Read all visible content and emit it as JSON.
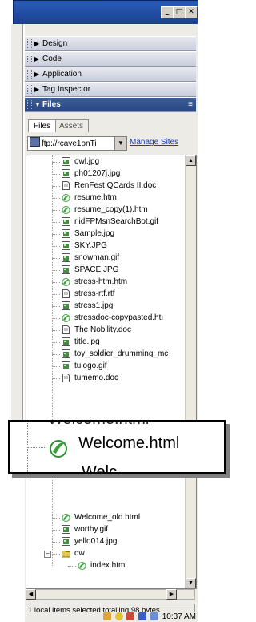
{
  "window": {
    "buttons": {
      "minimize": "_",
      "restore": "□",
      "close": "✕"
    }
  },
  "panels": [
    {
      "label": "Design",
      "expanded": false
    },
    {
      "label": "Code",
      "expanded": false
    },
    {
      "label": "Application",
      "expanded": false
    },
    {
      "label": "Tag Inspector",
      "expanded": false
    }
  ],
  "files_panel": {
    "label": "Files",
    "tabs": [
      "Files",
      "Assets"
    ],
    "active_tab": "Files",
    "site_select": "ftp://rcave1onTi",
    "manage_sites": "Manage Sites",
    "items": [
      {
        "name": "owl.jpg",
        "type": "image"
      },
      {
        "name": "ph01207j.jpg",
        "type": "image"
      },
      {
        "name": "RenFest QCards II.doc",
        "type": "doc"
      },
      {
        "name": "resume.htm",
        "type": "html"
      },
      {
        "name": "resume_copy(1).htm",
        "type": "html"
      },
      {
        "name": "rlidFPMsnSearchBot.gif",
        "type": "image"
      },
      {
        "name": "Sample.jpg",
        "type": "image"
      },
      {
        "name": "SKY.JPG",
        "type": "image"
      },
      {
        "name": "snowman.gif",
        "type": "image"
      },
      {
        "name": "SPACE.JPG",
        "type": "image"
      },
      {
        "name": "stress-htm.htm",
        "type": "html"
      },
      {
        "name": "stress-rtf.rtf",
        "type": "doc"
      },
      {
        "name": "stress1.jpg",
        "type": "image"
      },
      {
        "name": "stressdoc-copypasted.htı",
        "type": "html"
      },
      {
        "name": "The Nobility.doc",
        "type": "doc"
      },
      {
        "name": "title.jpg",
        "type": "image"
      },
      {
        "name": "toy_soldier_drumming_mc",
        "type": "image"
      },
      {
        "name": "tulogo.gif",
        "type": "image"
      },
      {
        "name": "tumemo.doc",
        "type": "doc"
      }
    ],
    "items_after": [
      {
        "name": "Welcome_old.html",
        "type": "html"
      },
      {
        "name": "worthy.gif",
        "type": "image"
      },
      {
        "name": "yello014.jpg",
        "type": "image"
      }
    ],
    "folder": {
      "name": "dw",
      "children": [
        {
          "name": "index.htm",
          "type": "html"
        }
      ]
    },
    "status": "1 local items selected totalling 98 bytes."
  },
  "magnifier": {
    "top_text": "Welcome.html",
    "main_text": "Welcome.html",
    "bottom_text": "Welc"
  },
  "taskbar": {
    "time": "10:37 AM"
  },
  "colors": {
    "title_bar": "#2a5db8",
    "files_header": "#2a4680",
    "link": "#1a36c8",
    "html_icon": "#3aa03a",
    "image_icon": "#3f8f3f",
    "folder_icon": "#e4c84a"
  }
}
